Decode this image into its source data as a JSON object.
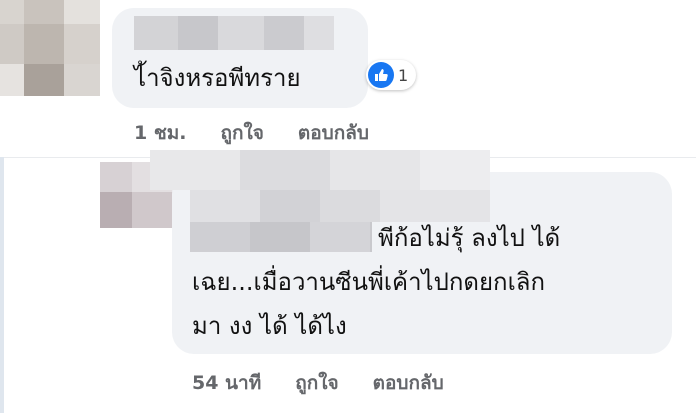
{
  "comment1": {
    "text": "ไ้าจิงหรอพีทราย",
    "reaction_count": "1",
    "time": "1 ชม.",
    "like_label": "ถูกใจ",
    "reply_label": "ตอบกลับ"
  },
  "comment2": {
    "line1": "พีก้อไม่รุ้ ลงไป ได้",
    "line2": "เฉย...เมื่อวานซีนพี่เค้าไปกดยกเลิก",
    "line3": "มา งง ได้ ได้ไง",
    "time": "54 นาที",
    "like_label": "ถูกใจ",
    "reply_label": "ตอบกลับ"
  },
  "icons": {
    "reaction": "like-thumb-icon"
  },
  "colors": {
    "bubble": "#f0f2f5",
    "meta_text": "#65676b",
    "like_blue": "#1877f2"
  }
}
